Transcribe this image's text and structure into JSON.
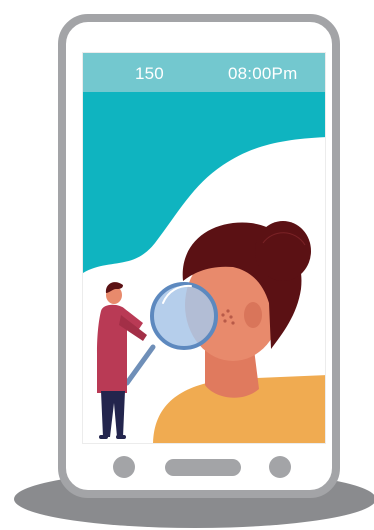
{
  "status_bar": {
    "count": "150",
    "time": "08:00Pm"
  },
  "colors": {
    "status_bar": "#73c8cf",
    "teal_background": "#0fb4c0",
    "phone_frame": "#a3a4a7",
    "shadow": "#8a8b8e",
    "hair": "#5b1114",
    "skin": "#e88a6c",
    "sweater": "#f0ab51",
    "doctor_coat": "#b93a55",
    "doctor_pants": "#23254d",
    "lens": "#a8c6e8"
  },
  "icons": {
    "illustration": "dermatologist-with-magnifier-illustration"
  }
}
